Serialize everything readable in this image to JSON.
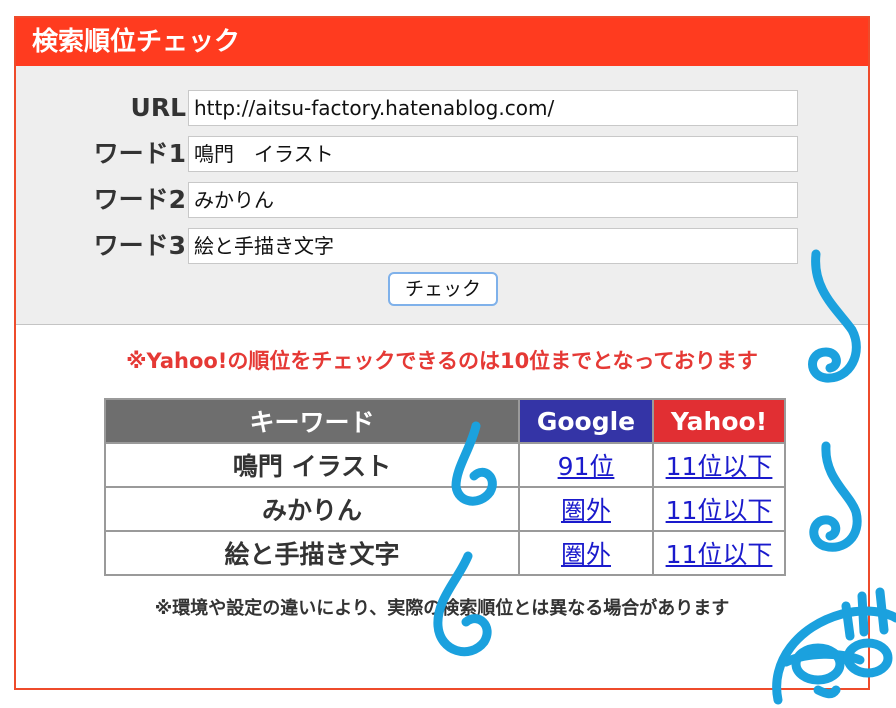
{
  "title": "検索順位チェック",
  "form": {
    "url_label": "URL",
    "url_value": "http://aitsu-factory.hatenablog.com/",
    "word1_label": "ワード1",
    "word1_value": "鳴門　イラスト",
    "word2_label": "ワード2",
    "word2_value": "みかりん",
    "word3_label": "ワード3",
    "word3_value": "絵と手描き文字",
    "check_label": "チェック"
  },
  "notice": "※Yahoo!の順位をチェックできるのは10位までとなっております",
  "table": {
    "headers": {
      "keyword": "キーワード",
      "google": "Google",
      "yahoo": "Yahoo!"
    },
    "rows": [
      {
        "keyword": "鳴門 イラスト",
        "google": "91位",
        "yahoo": "11位以下"
      },
      {
        "keyword": "みかりん",
        "google": "圏外",
        "yahoo": "11位以下"
      },
      {
        "keyword": "絵と手描き文字",
        "google": "圏外",
        "yahoo": "11位以下"
      }
    ]
  },
  "footnote": "※環境や設定の違いにより、実際の検索順位とは異なる場合があります",
  "colors": {
    "accent": "#ff3b1f",
    "google_header": "#3434a6",
    "yahoo_header": "#e12f33",
    "keyword_header": "#6e6e6e",
    "doodle": "#1ba1de"
  }
}
